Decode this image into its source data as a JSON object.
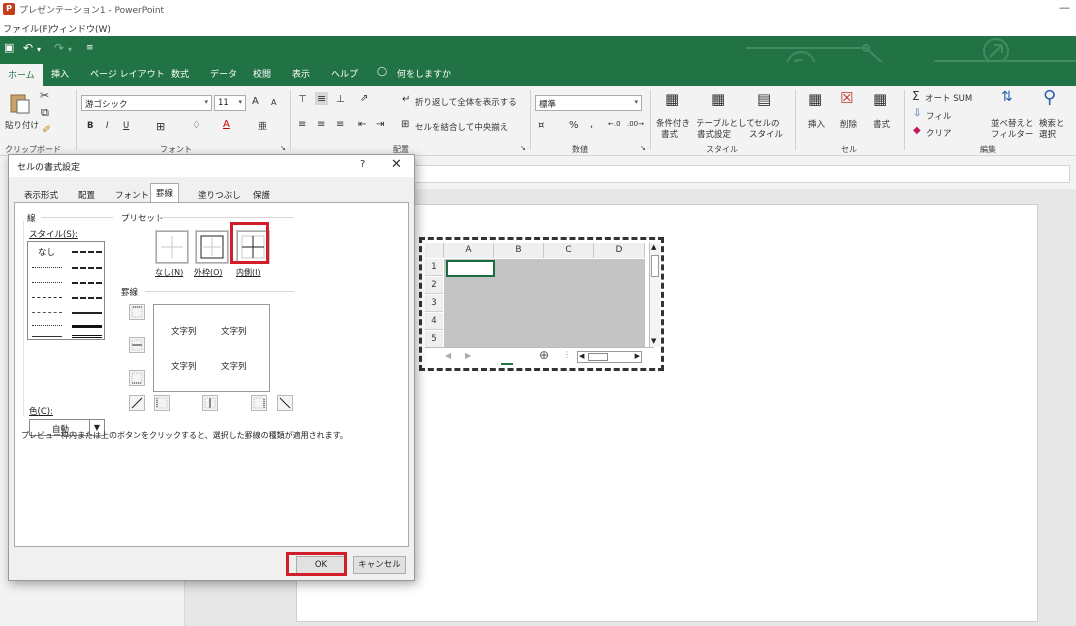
{
  "window": {
    "title": "プレゼンテーション1 - PowerPoint",
    "app_icon_letter": "P"
  },
  "menu": [
    "ファイル(F)",
    "ウィンドウ(W)"
  ],
  "quick_access": {
    "save": "save-icon",
    "undo": "undo-icon",
    "redo": "redo-icon"
  },
  "ribbon_tabs": [
    "ホーム",
    "挿入",
    "ページ レイアウト",
    "数式",
    "データ",
    "校閲",
    "表示",
    "ヘルプ",
    "何をしますか"
  ],
  "ribbon": {
    "clipboard": {
      "paste": "貼り付け",
      "label": "クリップボード"
    },
    "font": {
      "name": "游ゴシック",
      "size": "11",
      "bold": "B",
      "italic": "I",
      "underline": "U",
      "grow": "A",
      "shrink": "A",
      "label": "フォント"
    },
    "alignment": {
      "wrap": "折り返して全体を表示する",
      "merge": "セルを結合して中央揃え",
      "label": "配置"
    },
    "number": {
      "format": "標準",
      "percent": "%",
      "comma": ",",
      "label": "数値"
    },
    "styles": {
      "conditional": [
        "条件付き",
        "書式"
      ],
      "table": [
        "テーブルとして",
        "書式設定"
      ],
      "cell": [
        "セルの",
        "スタイル"
      ],
      "label": "スタイル"
    },
    "cells": {
      "insert": "挿入",
      "delete": "削除",
      "format": "書式",
      "label": "セル"
    },
    "editing": {
      "autosum": "オート SUM",
      "fill": "フィル",
      "clear": "クリア",
      "sort": [
        "並べ替えと",
        "フィルター"
      ],
      "find": [
        "検索と",
        "選択"
      ],
      "label": "編集"
    }
  },
  "embedded_sheet": {
    "columns": [
      "A",
      "B",
      "C",
      "D"
    ],
    "rows": [
      "1",
      "2",
      "3",
      "4",
      "5"
    ]
  },
  "dialog": {
    "title": "セルの書式設定",
    "help": "?",
    "close": "✕",
    "tabs": [
      "表示形式",
      "配置",
      "フォント",
      "罫線",
      "塗りつぶし",
      "保護"
    ],
    "active_tab": "罫線",
    "line_section": "線",
    "style_label": "スタイル(S):",
    "none_style": "なし",
    "color_label": "色(C):",
    "color_value": "自動",
    "preset_section": "プリセット",
    "presets": [
      "なし(N)",
      "外枠(O)",
      "内側(I)"
    ],
    "border_section": "罫線",
    "preview_text": "文字列",
    "hint": "プレビュー枠内または上のボタンをクリックすると、選択した罫線の種類が適用されます。",
    "ok": "OK",
    "cancel": "キャンセル"
  },
  "colors": {
    "excel_green": "#217346",
    "highlight_red": "#d21e2b"
  }
}
